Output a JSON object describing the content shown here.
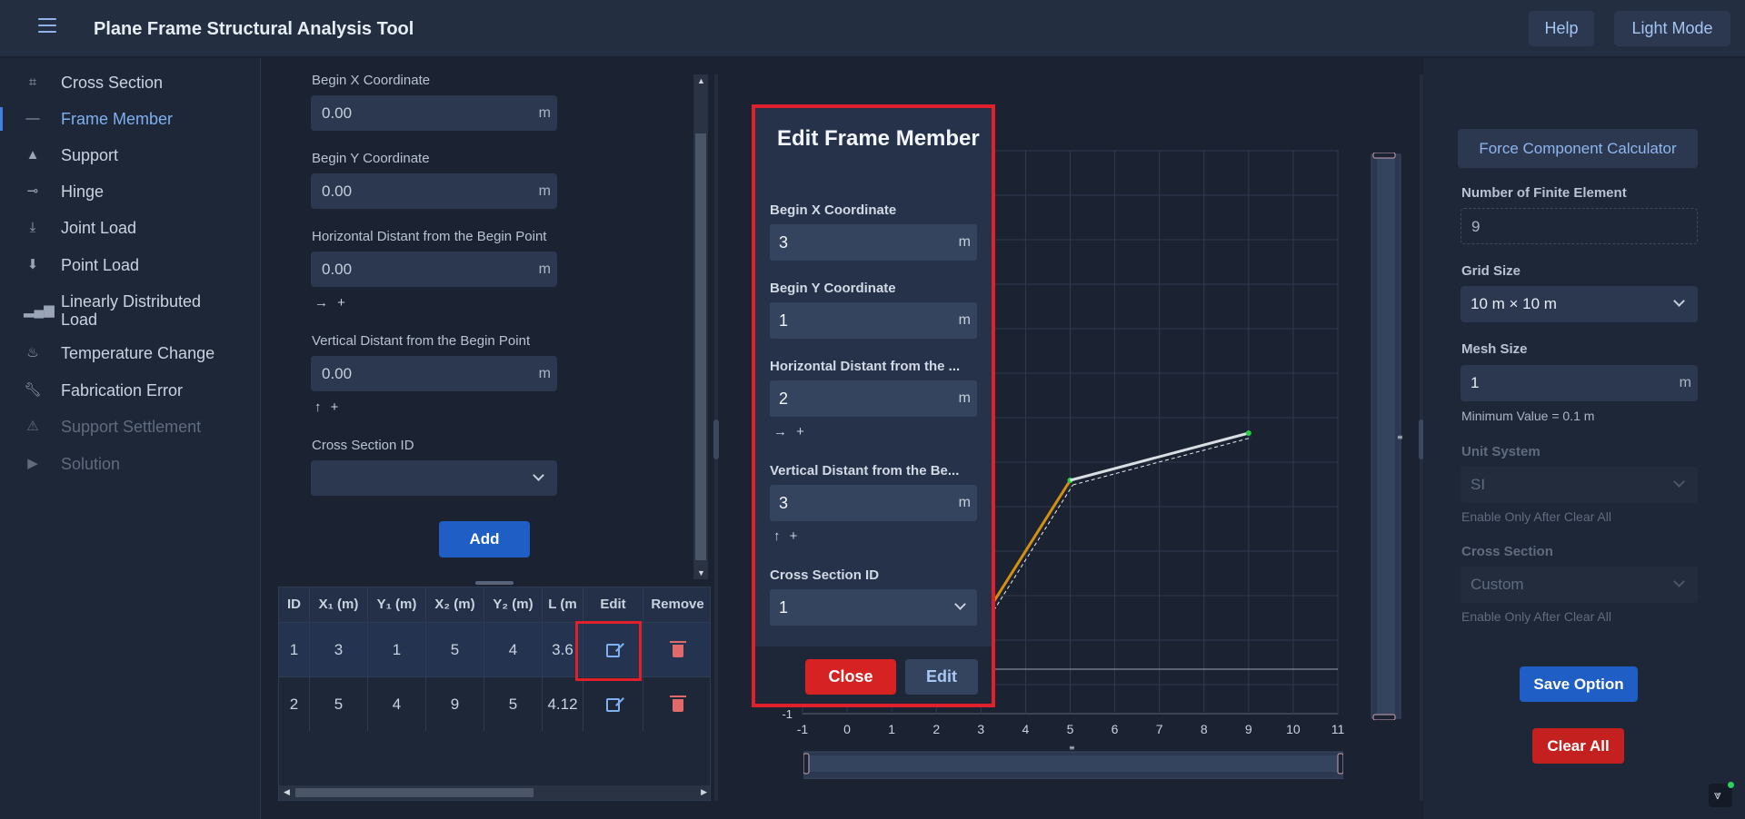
{
  "app": {
    "title": "Plane Frame Structural Analysis Tool",
    "help": "Help",
    "mode": "Light Mode"
  },
  "sidebar": {
    "items": [
      {
        "label": "Cross Section",
        "icon": "crop-square-icon",
        "state": "normal"
      },
      {
        "label": "Frame Member",
        "icon": "line-icon",
        "state": "active"
      },
      {
        "label": "Support",
        "icon": "triangle-icon",
        "state": "normal"
      },
      {
        "label": "Hinge",
        "icon": "hinge-icon",
        "state": "normal"
      },
      {
        "label": "Joint Load",
        "icon": "joint-load-icon",
        "state": "normal"
      },
      {
        "label": "Point Load",
        "icon": "download-arrow-icon",
        "state": "normal"
      },
      {
        "label": "Linearly Distributed",
        "label2": "Load",
        "icon": "bar-chart-icon",
        "state": "normal"
      },
      {
        "label": "Temperature Change",
        "icon": "flame-icon",
        "state": "normal"
      },
      {
        "label": "Fabrication Error",
        "icon": "wrench-icon",
        "state": "normal"
      },
      {
        "label": "Support Settlement",
        "icon": "warning-icon",
        "state": "disabled"
      },
      {
        "label": "Solution",
        "icon": "play-icon",
        "state": "disabled"
      }
    ]
  },
  "form": {
    "begin_x_label": "Begin X Coordinate",
    "begin_x_value": "0.00",
    "unit": "m",
    "begin_y_label": "Begin Y Coordinate",
    "begin_y_value": "0.00",
    "h_label": "Horizontal Distant from the Begin Point",
    "h_value": "0.00",
    "h_arrow": "→ +",
    "v_label": "Vertical Distant from the Begin Point",
    "v_value": "0.00",
    "v_arrow": "↑ +",
    "cs_label": "Cross Section ID",
    "cs_value": "",
    "add": "Add"
  },
  "table": {
    "headers": [
      "ID",
      "X₁ (m)",
      "Y₁ (m)",
      "X₂ (m)",
      "Y₂ (m)",
      "L (m",
      "Edit",
      "Remove"
    ],
    "rows": [
      [
        "1",
        "3",
        "1",
        "5",
        "4",
        "3.6"
      ],
      [
        "2",
        "5",
        "4",
        "9",
        "5",
        "4.12"
      ]
    ]
  },
  "plot": {
    "x_ticks": [
      "-1",
      "0",
      "1",
      "2",
      "3",
      "4",
      "5",
      "6",
      "7",
      "8",
      "9",
      "10",
      "11"
    ],
    "y_ticks": [
      "-1"
    ],
    "grid": true,
    "members": [
      {
        "x1": 3,
        "y1": 1,
        "x2": 5,
        "y2": 4,
        "color": "#d4900e"
      },
      {
        "x1": 5,
        "y1": 4,
        "x2": 9,
        "y2": 5,
        "color": "#d9dde4"
      }
    ],
    "node_color": "#27d13f"
  },
  "modal": {
    "title": "Edit Frame Member",
    "begin_x_label": "Begin X Coordinate",
    "begin_x_value": "3",
    "unit": "m",
    "begin_y_label": "Begin Y Coordinate",
    "begin_y_value": "1",
    "h_label": "Horizontal Distant from the ...",
    "h_value": "2",
    "h_arrow": "→ +",
    "v_label": "Vertical Distant from the Be...",
    "v_value": "3",
    "v_arrow": "↑ +",
    "cs_label": "Cross Section ID",
    "cs_value": "1",
    "close": "Close",
    "edit": "Edit"
  },
  "right": {
    "fcc": "Force Component Calculator",
    "nfe_label": "Number of Finite Element",
    "nfe_value": "9",
    "grid_label": "Grid Size",
    "grid_value": "10 m × 10 m",
    "mesh_label": "Mesh Size",
    "mesh_value": "1",
    "mesh_unit": "m",
    "mesh_hint": "Minimum Value = 0.1 m",
    "unit_label": "Unit System",
    "unit_value": "SI",
    "unit_hint": "Enable Only After Clear All",
    "cs_label": "Cross Section",
    "cs_value": "Custom",
    "cs_hint": "Enable Only After Clear All",
    "save": "Save Option",
    "clear": "Clear All"
  },
  "colors": {
    "accent": "#3f7fe0",
    "danger": "#e0202a",
    "background": "#1b2333"
  }
}
